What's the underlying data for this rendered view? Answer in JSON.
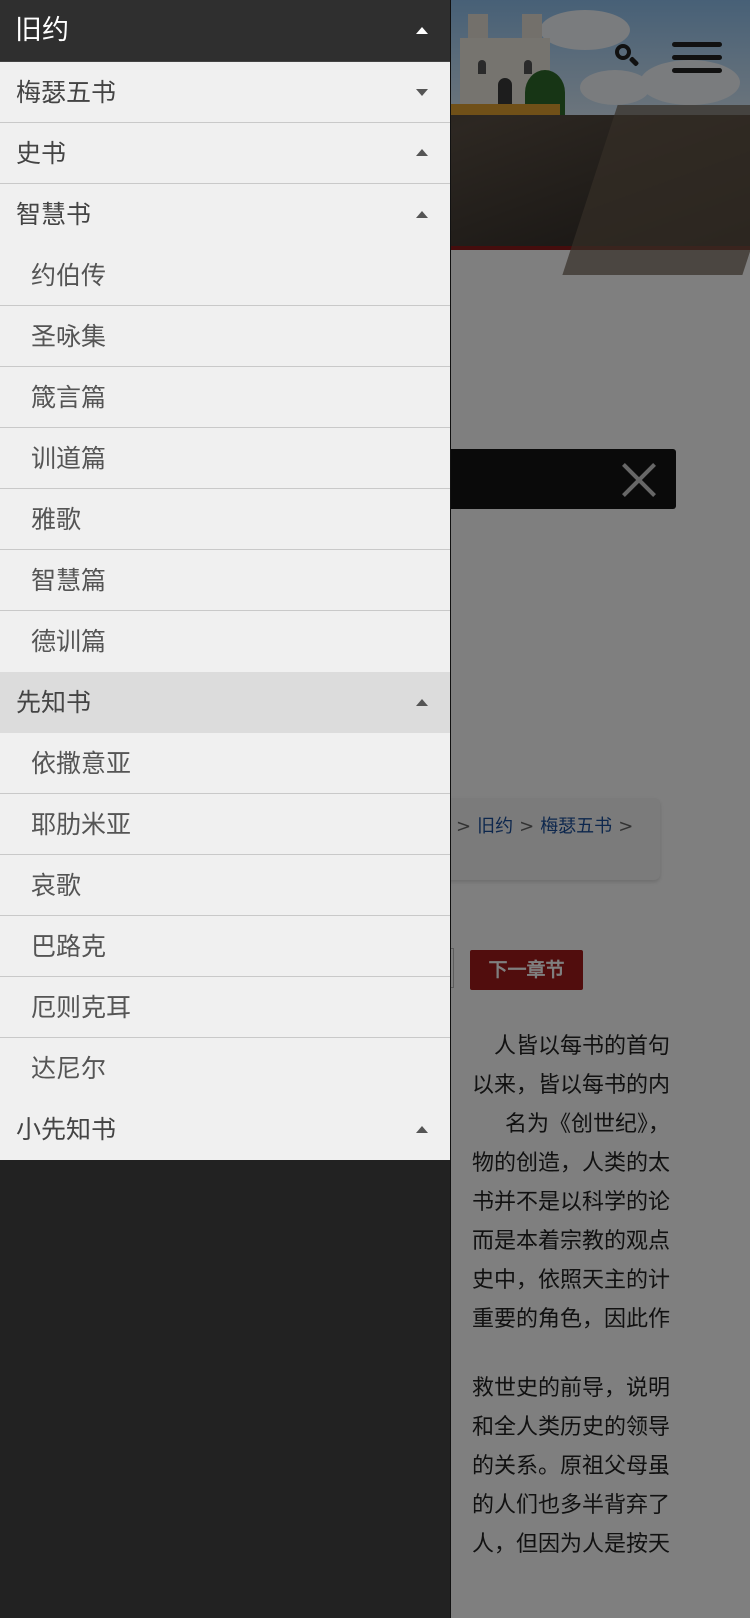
{
  "header": {
    "search_icon": "search-icon",
    "menu_icon": "hamburger-menu-icon"
  },
  "breadcrumb": {
    "sep1": ">",
    "item1": "旧约",
    "sep2": ">",
    "item2": "梅瑟五书",
    "sep3": ">"
  },
  "nav_buttons": {
    "next_label": "下一章节"
  },
  "article": {
    "lines": [
      "人皆以每书的首句",
      "以来，皆以每书的内",
      "名为《创世纪》，",
      "物的创造，人类的太",
      "书并不是以科学的论",
      "而是本着宗教的观点",
      "史中，依照天主的计",
      "重要的角色，因此作"
    ],
    "lines2": [
      "救世史的前导，说明",
      "和全人类历史的领导",
      "的关系。原祖父母虽",
      "的人们也多半背弃了",
      "人，但因为人是按天"
    ]
  },
  "drawer": {
    "title": "旧约",
    "sections": {
      "pentateuch": "梅瑟五书",
      "history": "史书",
      "wisdom": "智慧书",
      "prophets": "先知书",
      "minor_prophets": "小先知书"
    },
    "wisdom_books": [
      "约伯传",
      "圣咏集",
      "箴言篇",
      "训道篇",
      "雅歌",
      "智慧篇",
      "德训篇"
    ],
    "prophet_books": [
      "依撒意亚",
      "耶肋米亚",
      "哀歌",
      "巴路克",
      "厄则克耳",
      "达尼尔"
    ]
  },
  "colors": {
    "accent_red": "#a31b1b",
    "link_blue": "#1a4e9a",
    "drawer_dark": "#222222",
    "menu_bg": "#f0f0f0"
  }
}
